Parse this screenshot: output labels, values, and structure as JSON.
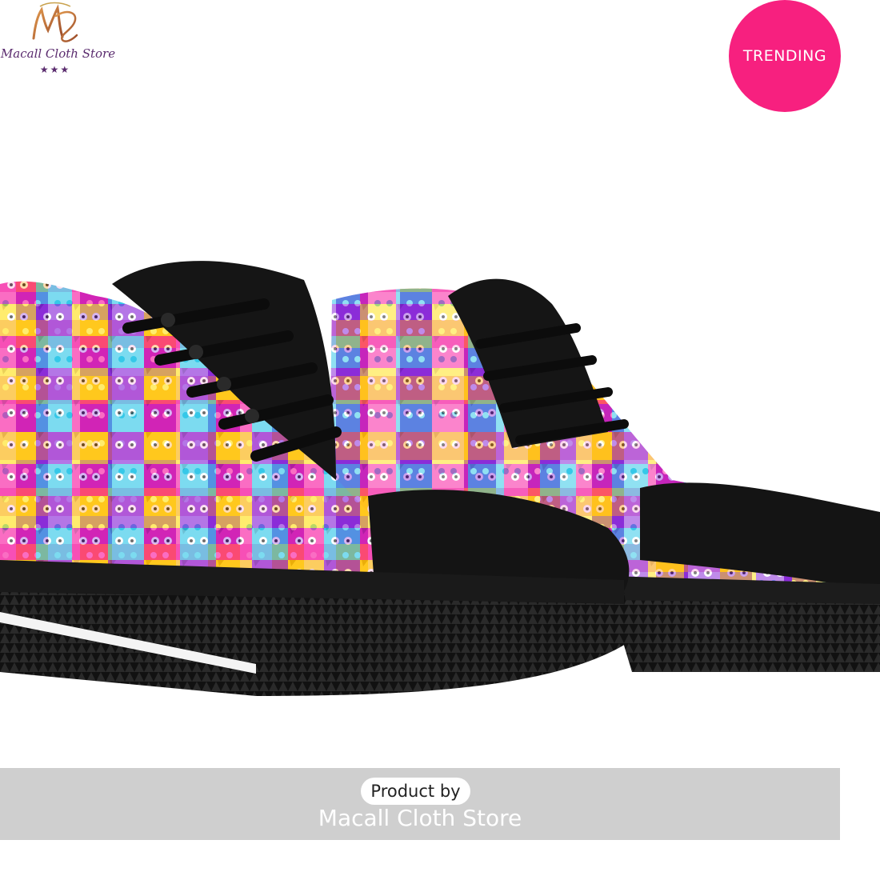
{
  "logo": {
    "mark": "M",
    "name": "Macall Cloth Store",
    "stars": "★★★"
  },
  "badge": {
    "label": "TRENDING",
    "color": "#f7207f"
  },
  "product": {
    "image": "colorful-cat-pattern-high-top-sneakers",
    "pattern_colors": [
      "#f71fa3",
      "#35c8e8",
      "#ffe11f",
      "#8b2cd8",
      "#ff9a1a",
      "#f7a8d8",
      "#ffffff"
    ]
  },
  "footer": {
    "label": "Product by",
    "store_name": "Macall Cloth Store"
  }
}
